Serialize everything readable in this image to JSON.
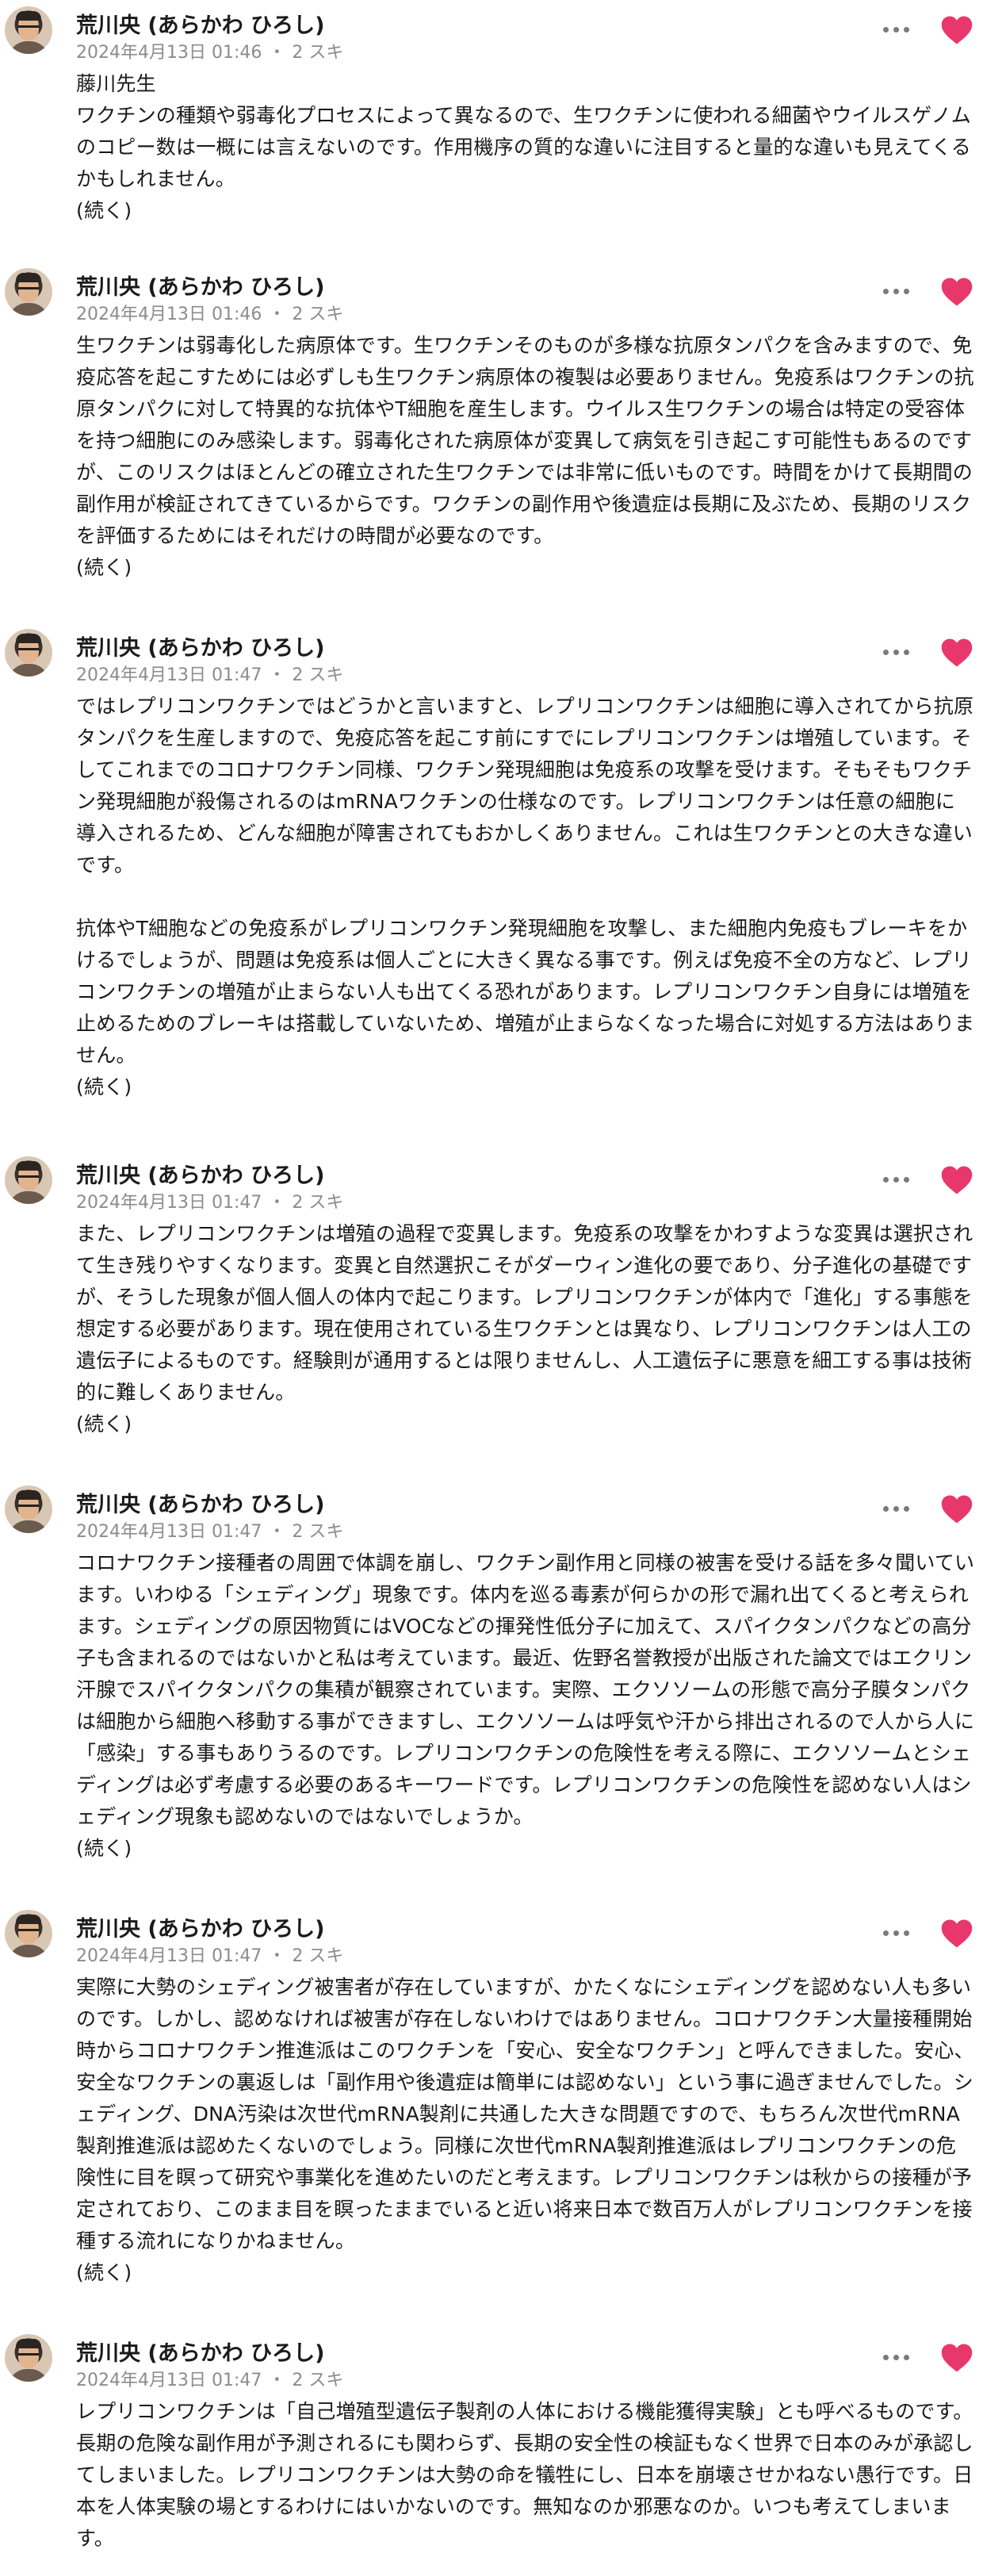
{
  "author_name": "荒川央 (あらかわ ひろし)",
  "like_label": "スキ",
  "continue_label": "(続く)",
  "colors": {
    "heart": "#e8376b",
    "meta": "#8c8c8c",
    "text": "#1a1a1a"
  },
  "icons": {
    "menu": "more-horizontal-icon",
    "like": "heart-icon"
  },
  "comments": [
    {
      "timestamp": "2024年4月13日 01:46",
      "likes": "2",
      "body": "藤川先生\nワクチンの種類や弱毒化プロセスによって異なるので、生ワクチンに使われる細菌やウイルスゲノムのコピー数は一概には言えないのです。作用機序の質的な違いに注目すると量的な違いも見えてくるかもしれません。",
      "more": "(続く)"
    },
    {
      "timestamp": "2024年4月13日 01:46",
      "likes": "2",
      "body": "生ワクチンは弱毒化した病原体です。生ワクチンそのものが多様な抗原タンパクを含みますので、免疫応答を起こすためには必ずしも生ワクチン病原体の複製は必要ありません。免疫系はワクチンの抗原タンパクに対して特異的な抗体やT細胞を産生します。ウイルス生ワクチンの場合は特定の受容体を持つ細胞にのみ感染します。弱毒化された病原体が変異して病気を引き起こす可能性もあるのですが、このリスクはほとんどの確立された生ワクチンでは非常に低いものです。時間をかけて長期間の副作用が検証されてきているからです。ワクチンの副作用や後遺症は長期に及ぶため、長期のリスクを評価するためにはそれだけの時間が必要なのです。",
      "more": "(続く)"
    },
    {
      "timestamp": "2024年4月13日 01:47",
      "likes": "2",
      "body": "ではレプリコンワクチンではどうかと言いますと、レプリコンワクチンは細胞に導入されてから抗原タンパクを生産しますので、免疫応答を起こす前にすでにレプリコンワクチンは増殖しています。そしてこれまでのコロナワクチン同様、ワクチン発現細胞は免疫系の攻撃を受けます。そもそもワクチン発現細胞が殺傷されるのはmRNAワクチンの仕様なのです。レプリコンワクチンは任意の細胞に導入されるため、どんな細胞が障害されてもおかしくありません。これは生ワクチンとの大きな違いです。\n\n抗体やT細胞などの免疫系がレプリコンワクチン発現細胞を攻撃し、また細胞内免疫もブレーキをかけるでしょうが、問題は免疫系は個人ごとに大きく異なる事です。例えば免疫不全の方など、レプリコンワクチンの増殖が止まらない人も出てくる恐れがあります。レプリコンワクチン自身には増殖を止めるためのブレーキは搭載していないため、増殖が止まらなくなった場合に対処する方法はありません。",
      "more": "(続く)"
    },
    {
      "timestamp": "2024年4月13日 01:47",
      "likes": "2",
      "body": "また、レプリコンワクチンは増殖の過程で変異します。免疫系の攻撃をかわすような変異は選択されて生き残りやすくなります。変異と自然選択こそがダーウィン進化の要であり、分子進化の基礎ですが、そうした現象が個人個人の体内で起こります。レプリコンワクチンが体内で「進化」する事態を想定する必要があります。現在使用されている生ワクチンとは異なり、レプリコンワクチンは人工の遺伝子によるものです。経験則が通用するとは限りませんし、人工遺伝子に悪意を細工する事は技術的に難しくありません。",
      "more": "(続く)"
    },
    {
      "timestamp": "2024年4月13日 01:47",
      "likes": "2",
      "body": "コロナワクチン接種者の周囲で体調を崩し、ワクチン副作用と同様の被害を受ける話を多々聞いています。いわゆる「シェディング」現象です。体内を巡る毒素が何らかの形で漏れ出てくると考えられます。シェディングの原因物質にはVOCなどの揮発性低分子に加えて、スパイクタンパクなどの高分子も含まれるのではないかと私は考えています。最近、佐野名誉教授が出版された論文ではエクリン汗腺でスパイクタンパクの集積が観察されています。実際、エクソソームの形態で高分子膜タンパクは細胞から細胞へ移動する事ができますし、エクソソームは呼気や汗から排出されるので人から人に「感染」する事もありうるのです。レプリコンワクチンの危険性を考える際に、エクソソームとシェディングは必ず考慮する必要のあるキーワードです。レプリコンワクチンの危険性を認めない人はシェディング現象も認めないのではないでしょうか。",
      "more": "(続く)"
    },
    {
      "timestamp": "2024年4月13日 01:47",
      "likes": "2",
      "body": "実際に大勢のシェディング被害者が存在していますが、かたくなにシェディングを認めない人も多いのです。しかし、認めなければ被害が存在しないわけではありません。コロナワクチン大量接種開始時からコロナワクチン推進派はこのワクチンを「安心、安全なワクチン」と呼んできました。安心、安全なワクチンの裏返しは「副作用や後遺症は簡単には認めない」という事に過ぎませんでした。シェディング、DNA汚染は次世代mRNA製剤に共通した大きな問題ですので、もちろん次世代mRNA製剤推進派は認めたくないのでしょう。同様に次世代mRNA製剤推進派はレプリコンワクチンの危険性に目を瞑って研究や事業化を進めたいのだと考えます。レプリコンワクチンは秋からの接種が予定されており、このまま目を瞑ったままでいると近い将来日本で数百万人がレプリコンワクチンを接種する流れになりかねません。",
      "more": "(続く)"
    },
    {
      "timestamp": "2024年4月13日 01:47",
      "likes": "2",
      "body": "レプリコンワクチンは「自己増殖型遺伝子製剤の人体における機能獲得実験」とも呼べるものです。長期の危険な副作用が予測されるにも関わらず、長期の安全性の検証もなく世界で日本のみが承認してしまいました。レプリコンワクチンは大勢の命を犠牲にし、日本を崩壊させかねない愚行です。日本を人体実験の場とするわけにはいかないのです。無知なのか邪悪なのか。いつも考えてしまいます。",
      "more": ""
    }
  ]
}
